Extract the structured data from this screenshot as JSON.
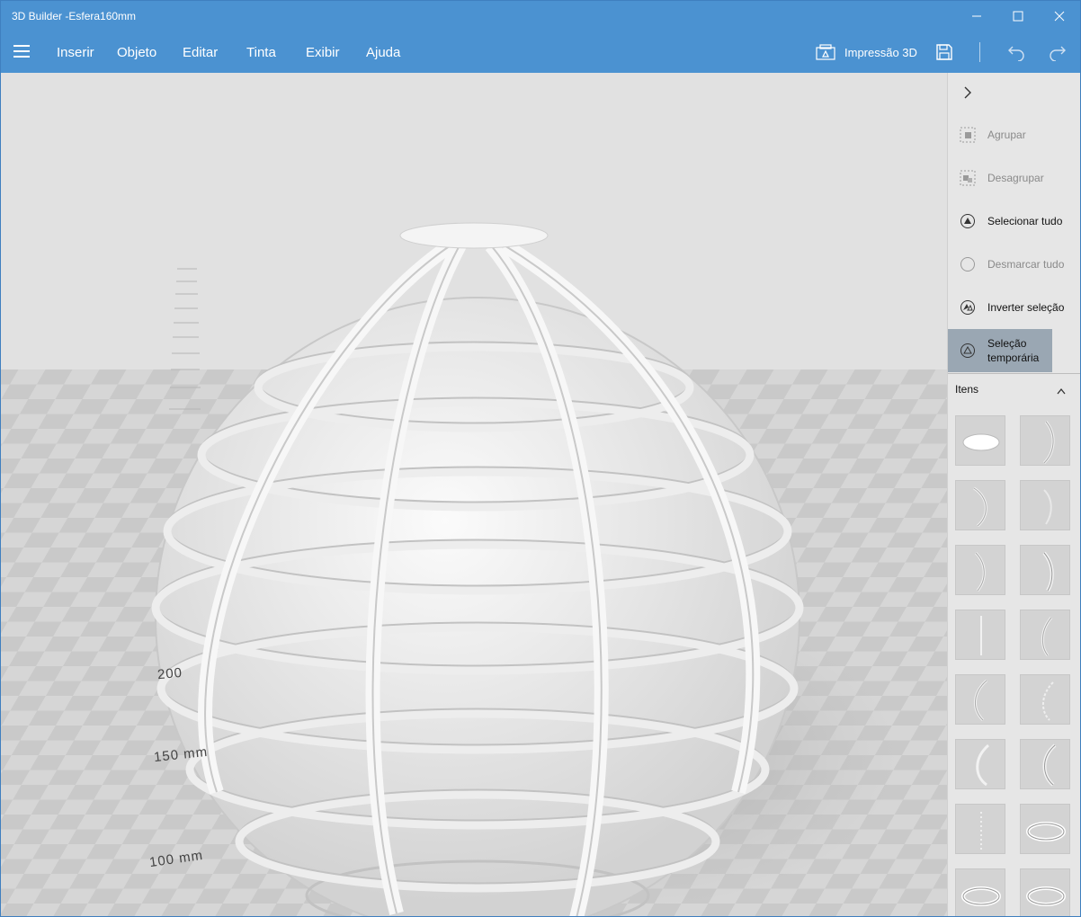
{
  "app": {
    "title": "3D Builder -Esfera160mm"
  },
  "menu": {
    "items": [
      "Inserir",
      "Objeto",
      "Editar",
      "Tinta",
      "Exibir",
      "Ajuda"
    ],
    "print_label": "Impressão 3D"
  },
  "panel": {
    "actions": [
      {
        "label": "Agrupar",
        "enabled": false
      },
      {
        "label": "Desagrupar",
        "enabled": false
      },
      {
        "label": "Selecionar tudo",
        "enabled": true
      },
      {
        "label": "Desmarcar tudo",
        "enabled": false
      },
      {
        "label": "Inverter seleção",
        "enabled": true
      },
      {
        "label": "Seleção temporária",
        "enabled": true,
        "active": true
      }
    ],
    "items_header": "Itens"
  },
  "viewport": {
    "ruler_labels": [
      "100 mm",
      "150 mm",
      "200"
    ]
  },
  "colors": {
    "accent": "#4b92d1",
    "panel": "#e6e6e6",
    "active": "#9aa7b3"
  }
}
